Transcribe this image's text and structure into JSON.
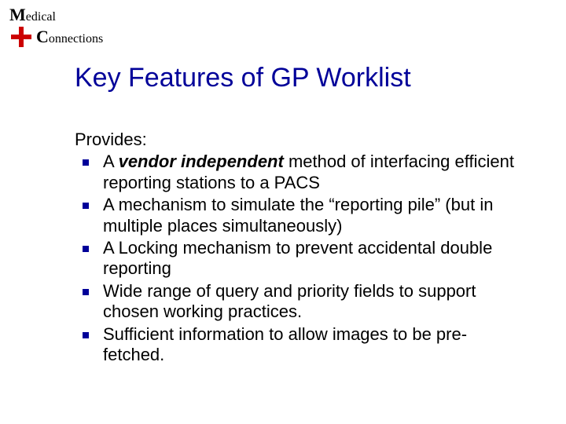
{
  "logo": {
    "word1_cap": "M",
    "word1_rest": "edical",
    "word2_cap": "C",
    "word2_rest": "onnections",
    "cross_color": "#cc0000"
  },
  "title": "Key Features of GP Worklist",
  "lead": "Provides:",
  "bullets": [
    {
      "prefix": "A ",
      "emph": "vendor independent",
      "suffix": " method of interfacing efficient reporting stations to a PACS"
    },
    {
      "prefix": "A mechanism to simulate the “reporting pile” (but in multiple places simultaneously)",
      "emph": "",
      "suffix": ""
    },
    {
      "prefix": "A Locking mechanism to prevent accidental double reporting",
      "emph": "",
      "suffix": ""
    },
    {
      "prefix": "Wide range of query and priority fields to support chosen working practices.",
      "emph": "",
      "suffix": ""
    },
    {
      "prefix": "Sufficient information to allow images to be pre-fetched.",
      "emph": "",
      "suffix": ""
    }
  ]
}
